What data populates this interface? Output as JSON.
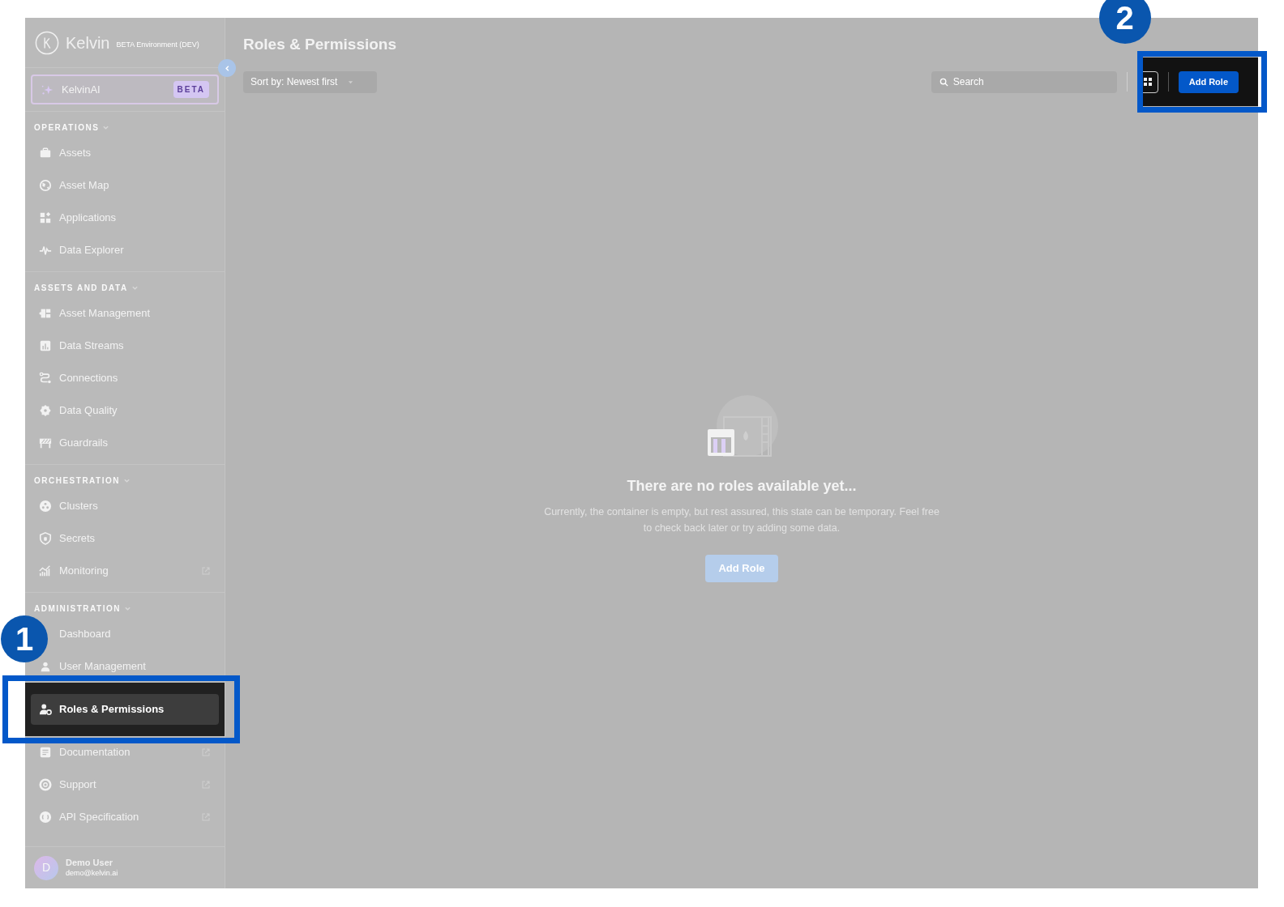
{
  "sidebar": {
    "logo": "Kelvin",
    "environment": "BETA Environment (DEV)",
    "ai_item": {
      "label": "KelvinAI",
      "badge": "BETA"
    },
    "sections": [
      {
        "title": "OPERATIONS",
        "items": [
          {
            "label": "Assets",
            "selected": false,
            "external": false
          },
          {
            "label": "Asset Map",
            "selected": false,
            "external": false
          },
          {
            "label": "Applications",
            "selected": false,
            "external": false
          },
          {
            "label": "Data Explorer",
            "selected": false,
            "external": false
          }
        ]
      },
      {
        "title": "ASSETS AND DATA",
        "items": [
          {
            "label": "Asset Management",
            "selected": false,
            "external": false
          },
          {
            "label": "Data Streams",
            "selected": false,
            "external": false
          },
          {
            "label": "Connections",
            "selected": false,
            "external": false
          },
          {
            "label": "Data Quality",
            "selected": false,
            "external": false
          },
          {
            "label": "Guardrails",
            "selected": false,
            "external": false
          }
        ]
      },
      {
        "title": "ORCHESTRATION",
        "items": [
          {
            "label": "Clusters",
            "selected": false,
            "external": false
          },
          {
            "label": "Secrets",
            "selected": false,
            "external": false
          },
          {
            "label": "Monitoring",
            "selected": false,
            "external": true
          }
        ]
      },
      {
        "title": "ADMINISTRATION",
        "items": [
          {
            "label": "Dashboard",
            "selected": false,
            "external": false
          },
          {
            "label": "User Management",
            "selected": false,
            "external": false
          },
          {
            "label": "Roles & Permissions",
            "selected": true,
            "external": false
          },
          {
            "label": "Documentation",
            "selected": false,
            "external": true
          },
          {
            "label": "Support",
            "selected": false,
            "external": true
          },
          {
            "label": "API Specification",
            "selected": false,
            "external": true
          }
        ]
      }
    ],
    "user": {
      "initial": "D",
      "name": "Demo User",
      "email": "demo@kelvin.ai"
    }
  },
  "page": {
    "title": "Roles & Permissions",
    "sort": "Sort by: Newest first",
    "search_placeholder": "Search",
    "add_button": "Add Role"
  },
  "empty_state": {
    "heading": "There are no roles available yet...",
    "text": "Currently, the container is empty, but rest assured, this state can be temporary. Feel free to check back later or try adding some data.",
    "button": "Add Role"
  },
  "annotations": [
    {
      "number": "1"
    },
    {
      "number": "2"
    }
  ]
}
